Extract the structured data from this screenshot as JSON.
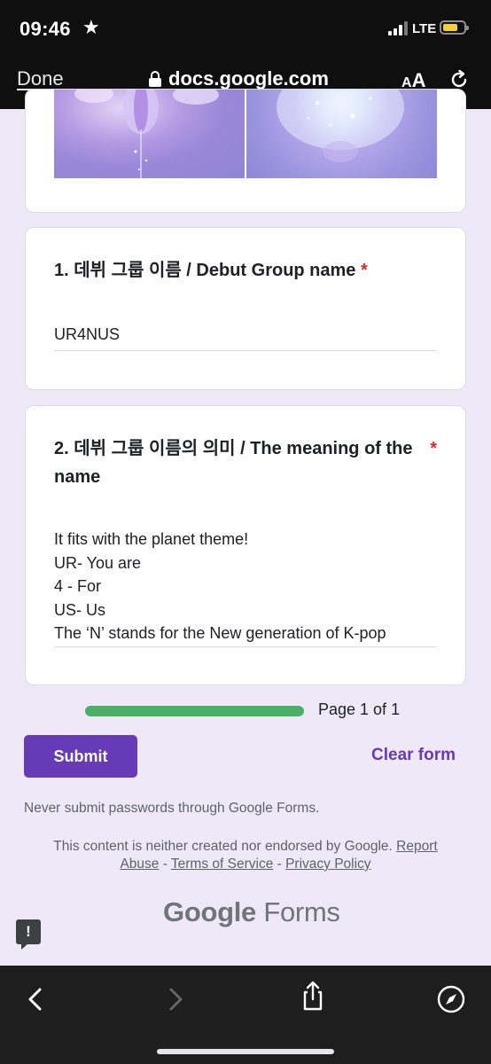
{
  "status_bar": {
    "time": "09:46",
    "star_icon": "star-icon",
    "network": "LTE"
  },
  "browser": {
    "done_label": "Done",
    "url": "docs.google.com",
    "text_size_small": "A",
    "text_size_big": "A"
  },
  "questions": [
    {
      "title": "1. 데뷔 그룹 이름 / Debut Group name",
      "required_mark": "*",
      "answer": "UR4NUS"
    },
    {
      "title": "2. 데뷔 그룹 이름의 의미 / The meaning of the name",
      "required_mark": "*",
      "answer_lines": [
        "It fits with the planet theme!",
        "UR- You are",
        "4 - For",
        "US- Us",
        "The ‘N’ stands for the New generation of K-pop"
      ]
    }
  ],
  "progress": {
    "fraction": 1.0,
    "label": "Page 1 of 1"
  },
  "actions": {
    "submit": "Submit",
    "clear": "Clear form"
  },
  "footer": {
    "warning": "Never submit passwords through Google Forms.",
    "disclaimer_prefix": "This content is neither created nor endorsed by Google.",
    "report_abuse": "Report Abuse",
    "sep1": " - ",
    "terms": "Terms of Service",
    "sep2": " - ",
    "privacy": "Privacy Policy",
    "logo_google": "Google",
    "logo_forms": "Forms",
    "feedback_icon_label": "!"
  },
  "colors": {
    "accent": "#673ab7",
    "progress": "#4caf66",
    "required": "#d93025",
    "page_bg": "#efe9f7"
  }
}
